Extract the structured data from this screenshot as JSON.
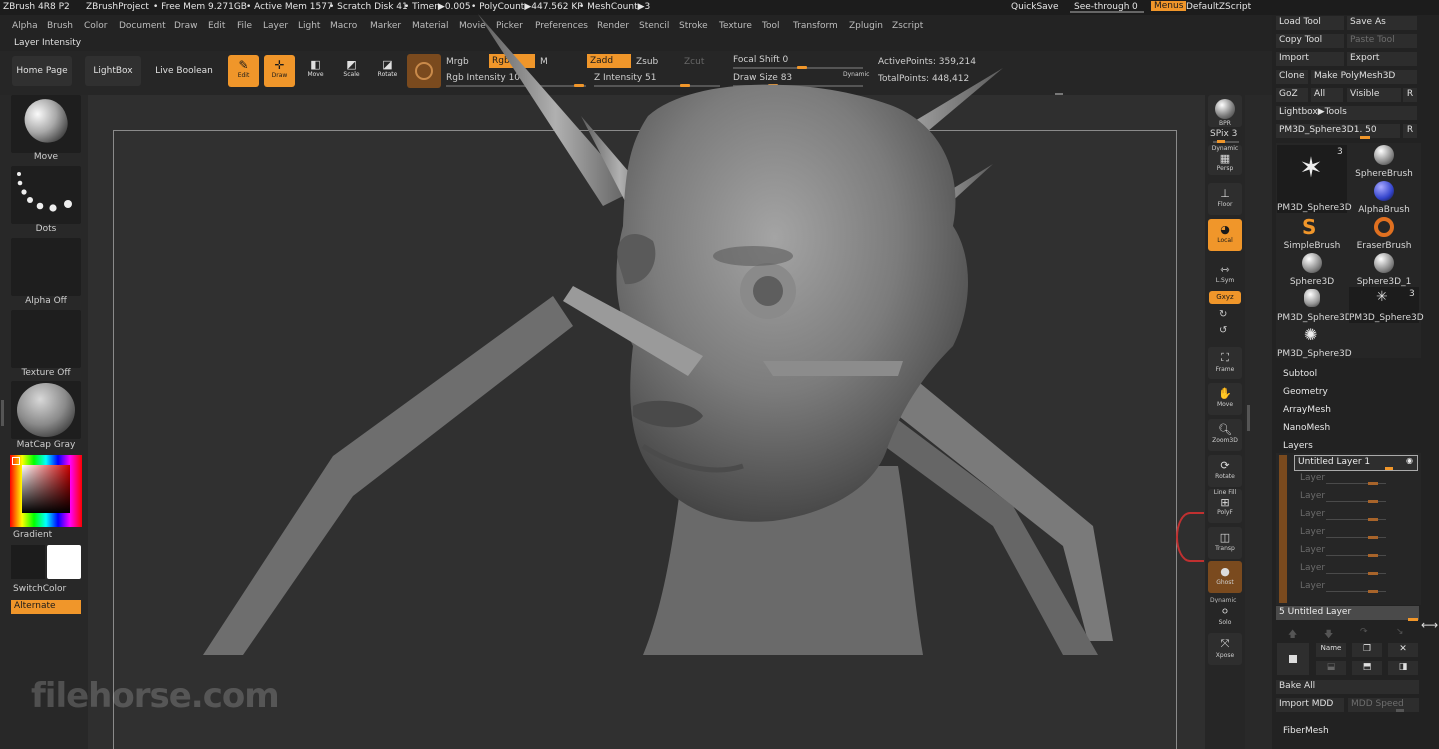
{
  "titlebar": {
    "app": "ZBrush 4R8 P2",
    "project": "ZBrushProject",
    "free_mem": "• Free Mem 9.271GB",
    "active_mem": "• Active Mem 1577",
    "scratch": "• Scratch Disk 41",
    "timer": "• Timer▶0.005",
    "polycount": "• PolyCount▶447.562 KP",
    "meshcount": "• MeshCount▶3",
    "quicksave": "QuickSave",
    "seethrough": "See-through",
    "seethrough_val": "0",
    "menus": "Menus",
    "script": "DefaultZScript"
  },
  "menu": [
    "Alpha",
    "Brush",
    "Color",
    "Document",
    "Draw",
    "Edit",
    "File",
    "Layer",
    "Light",
    "Macro",
    "Marker",
    "Material",
    "Movie",
    "Picker",
    "Preferences",
    "Render",
    "Stencil",
    "Stroke",
    "Texture",
    "Tool",
    "Transform",
    "Zplugin",
    "Zscript"
  ],
  "subbar": {
    "label": "Layer Intensity"
  },
  "toolbar": {
    "home": "Home Page",
    "lightbox": "LightBox",
    "liveboolean": "Live Boolean",
    "edit": "Edit",
    "draw": "Draw",
    "move": "Move",
    "scale": "Scale",
    "rotate": "Rotate",
    "mrgb": "Mrgb",
    "rgb": "Rgb",
    "m": "M",
    "rgb_intensity": "Rgb Intensity 100",
    "zadd": "Zadd",
    "zsub": "Zsub",
    "zcut": "Zcut",
    "z_intensity": "Z Intensity 51",
    "focal_shift": "Focal Shift 0",
    "draw_size": "Draw Size 83",
    "dynamic": "Dynamic",
    "active_points": "ActivePoints: 359,214",
    "total_points": "TotalPoints: 448,412"
  },
  "left": {
    "move": "Move",
    "dots": "Dots",
    "alpha": "Alpha Off",
    "texture": "Texture Off",
    "matcap": "MatCap Gray",
    "gradient": "Gradient",
    "switchcolor": "SwitchColor",
    "alternate": "Alternate"
  },
  "right": {
    "bpr": "BPR",
    "spix": "SPix 3",
    "dynamic": "Dynamic",
    "persp": "Persp",
    "floor": "Floor",
    "local": "Local",
    "lsym": "L.Sym",
    "xyz": "Gxyz",
    "frame": "Frame",
    "move": "Move",
    "zoom": "Zoom3D",
    "rotate": "Rotate",
    "linefill": "Line Fill",
    "polyf": "PolyF",
    "transp": "Transp",
    "ghost": "Ghost",
    "dynamic2": "Dynamic",
    "solo": "Solo",
    "xpose": "Xpose"
  },
  "panel": {
    "load_tool": "Load Tool",
    "save_as": "Save As",
    "copy_tool": "Copy Tool",
    "paste_tool": "Paste Tool",
    "import": "Import",
    "export": "Export",
    "clone": "Clone",
    "make_polymesh": "Make PolyMesh3D",
    "goz": "GoZ",
    "all": "All",
    "visible": "Visible",
    "r": "R",
    "lightbox_tools": "Lightbox▶Tools",
    "current_tool": "PM3D_Sphere3D1. 50",
    "tools": [
      {
        "name": "PM3D_Sphere3D",
        "badge": "3"
      },
      {
        "name": "SphereBrush",
        "badge": ""
      },
      {
        "name": "PM3D_Sphere3D",
        "badge": ""
      },
      {
        "name": "AlphaBrush",
        "badge": ""
      },
      {
        "name": "SimpleBrush",
        "badge": ""
      },
      {
        "name": "EraserBrush",
        "badge": ""
      },
      {
        "name": "Sphere3D",
        "badge": ""
      },
      {
        "name": "Sphere3D_1",
        "badge": ""
      },
      {
        "name": "PM3D_Sphere3D",
        "badge": ""
      },
      {
        "name": "PM3D_Sphere3D",
        "badge": "3"
      },
      {
        "name": "PM3D_Sphere3D",
        "badge": ""
      }
    ],
    "subtool": "Subtool",
    "geometry": "Geometry",
    "arraymesh": "ArrayMesh",
    "nanomesh": "NanoMesh",
    "layers": "Layers",
    "layer_active": "Untitled Layer 1",
    "layer_placeholder": "Layer",
    "layer_count_name": "5  Untitled Layer",
    "name_btn": "Name",
    "bake_all": "Bake All",
    "import_mdd": "Import MDD",
    "mdd_speed": "MDD Speed",
    "fibermesh": "FiberMesh"
  },
  "watermark": "filehorse.com",
  "colors": {
    "accent": "#f0962a",
    "bg": "#2b2b2b",
    "panel": "#222222"
  }
}
